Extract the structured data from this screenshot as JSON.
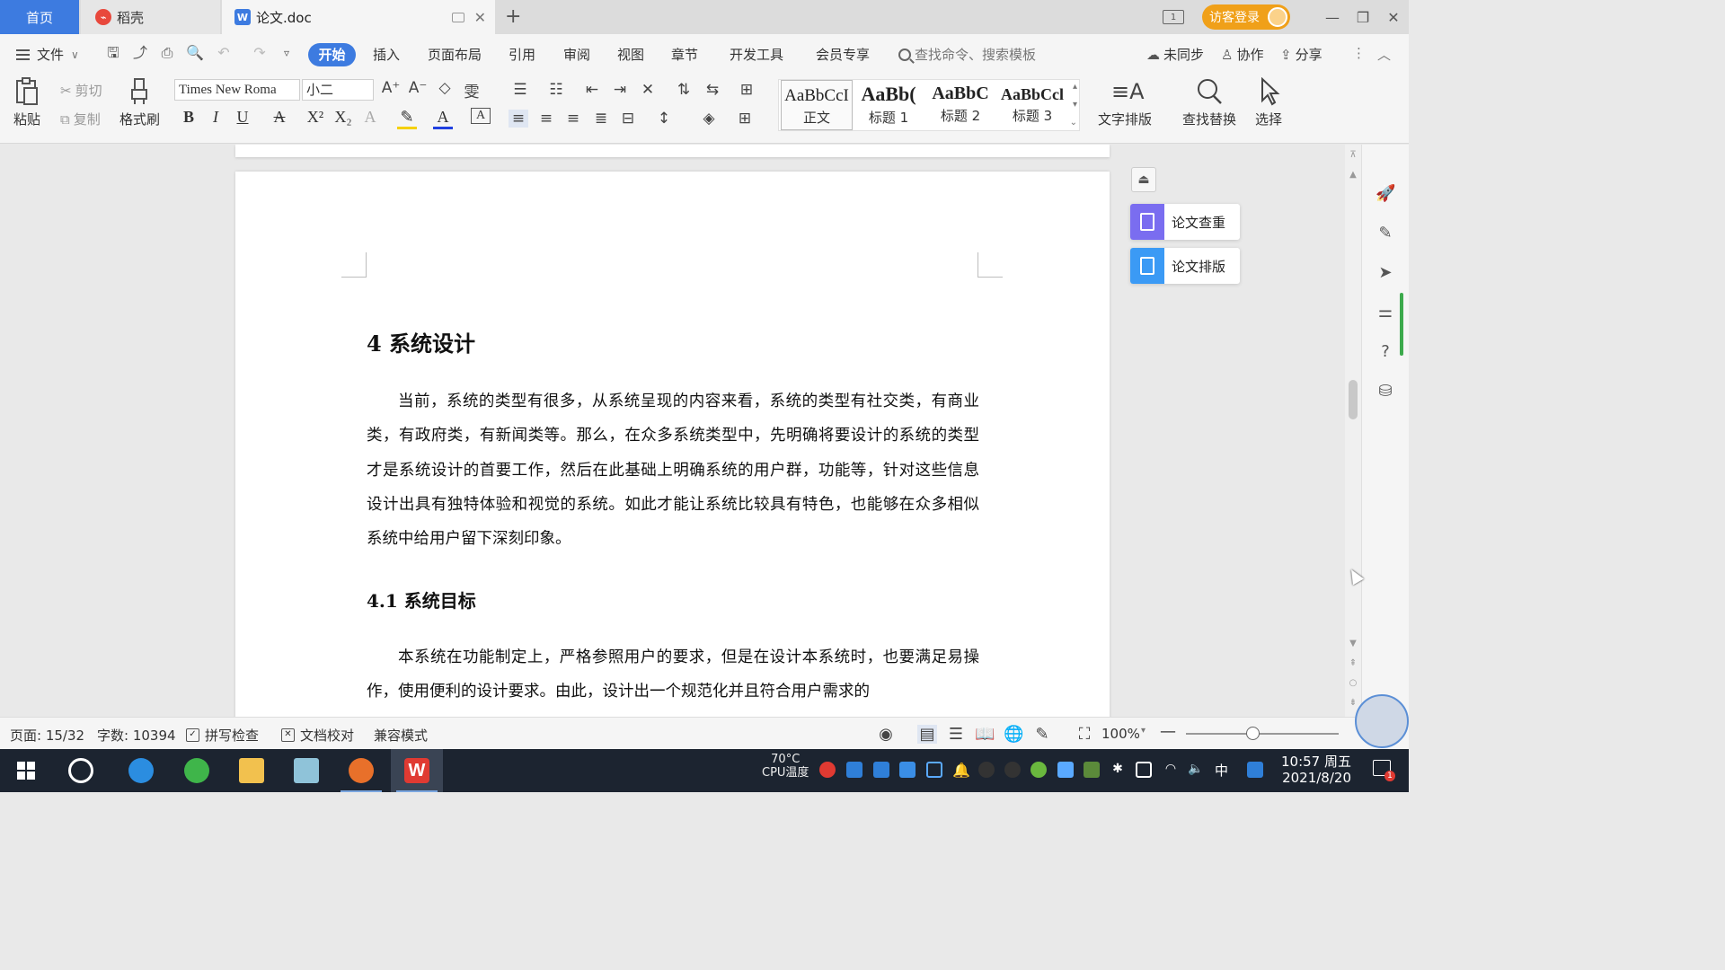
{
  "titlebar": {
    "tabs": [
      {
        "label": "首页"
      },
      {
        "label": "稻壳"
      },
      {
        "label": "论文.doc"
      }
    ],
    "new_tab": "+",
    "layout_badge": "1",
    "guest_login": "访客登录",
    "window_controls": {
      "minimize": "—",
      "restore": "❐",
      "close": "✕"
    }
  },
  "menu": {
    "file": "文件",
    "tabs": [
      "开始",
      "插入",
      "页面布局",
      "引用",
      "审阅",
      "视图",
      "章节",
      "开发工具",
      "会员专享"
    ],
    "search_placeholder": "查找命令、搜索模板",
    "right": [
      "未同步",
      "协作",
      "分享"
    ]
  },
  "ribbon": {
    "paste": "粘贴",
    "cut": "剪切",
    "copy": "复制",
    "format_painter": "格式刷",
    "font_name": "Times New Roma",
    "font_size": "小二",
    "styles": [
      {
        "preview": "AaBbCcI",
        "name": "正文"
      },
      {
        "preview": "AaBb(",
        "name": "标题 1"
      },
      {
        "preview": "AaBbC",
        "name": "标题 2"
      },
      {
        "preview": "AaBbCcl",
        "name": "标题 3"
      }
    ],
    "text_layout": "文字排版",
    "find_replace": "查找替换",
    "select": "选择"
  },
  "document": {
    "heading1": "4  系统设计",
    "para1": "当前，系统的类型有很多，从系统呈现的内容来看，系统的类型有社交类，有商业类，有政府类，有新闻类等。那么，在众多系统类型中，先明确将要设计的系统的类型才是系统设计的首要工作，然后在此基础上明确系统的用户群，功能等，针对这些信息设计出具有独特体验和视觉的系统。如此才能让系统比较具有特色，也能够在众多相似系统中给用户留下深刻印象。",
    "heading2": "4.1 系统目标",
    "para2": "本系统在功能制定上，严格参照用户的要求，但是在设计本系统时，也要满足易操作，使用便利的设计要求。由此，设计出一个规范化并且符合用户需求的"
  },
  "side_panel": {
    "paper_check": "论文查重",
    "paper_format": "论文排版"
  },
  "status": {
    "page": "页面: 15/32",
    "words": "字数: 10394",
    "spell_check": "拼写检查",
    "doc_proof": "文档校对",
    "compat_mode": "兼容模式",
    "zoom": "100%",
    "zoom_level": 0.44
  },
  "taskbar": {
    "cpu_temp": "70°C",
    "cpu_label": "CPU温度",
    "ime": "中",
    "time": "10:57 周五",
    "date": "2021/8/20",
    "notif_count": "1"
  },
  "colors": {
    "accent": "#3d7be0",
    "guest_login": "#f0a019",
    "paper_check": "#7a6df0",
    "paper_format": "#3b9af5",
    "wps_red": "#e03a32"
  }
}
